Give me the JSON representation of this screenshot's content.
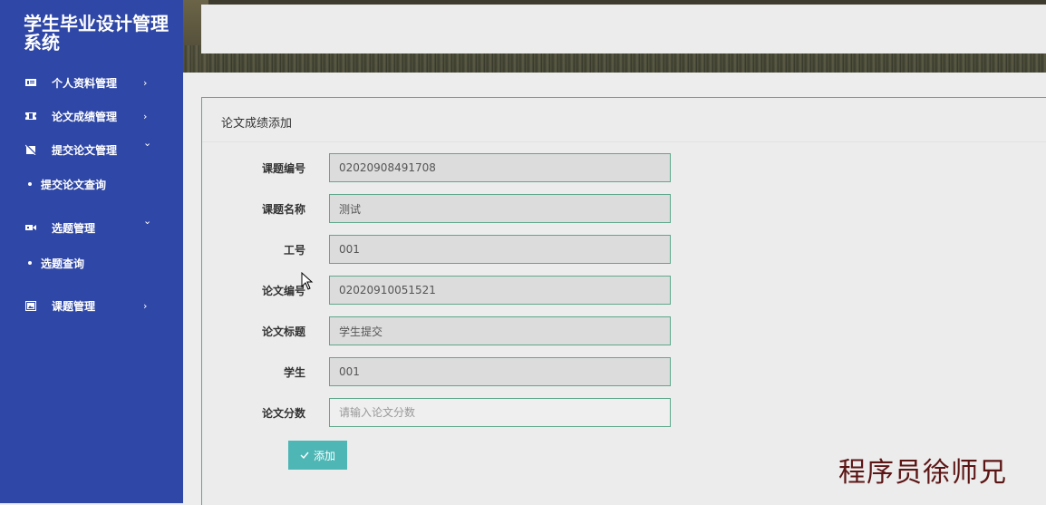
{
  "sidebar": {
    "app_title": "学生毕业设计管理系统",
    "items": [
      {
        "label": "个人资料管理",
        "icon": "id-card-icon",
        "arrow": "›"
      },
      {
        "label": "论文成绩管理",
        "icon": "ticket-icon",
        "arrow": "›"
      },
      {
        "label": "提交论文管理",
        "icon": "document-slash-icon",
        "arrow": "⌄"
      },
      {
        "label": "提交论文查询"
      },
      {
        "label": "选题管理",
        "icon": "video-camera-icon",
        "arrow": "⌄"
      },
      {
        "label": "选题查询"
      },
      {
        "label": "课题管理",
        "icon": "image-icon",
        "arrow": "›"
      }
    ]
  },
  "panel": {
    "title": "论文成绩添加"
  },
  "form": {
    "fields": [
      {
        "label": "课题编号",
        "value": "02020908491708"
      },
      {
        "label": "课题名称",
        "value": "测试"
      },
      {
        "label": "工号",
        "value": "001"
      },
      {
        "label": "论文编号",
        "value": "02020910051521"
      },
      {
        "label": "论文标题",
        "value": "学生提交"
      },
      {
        "label": "学生",
        "value": "001"
      },
      {
        "label": "论文分数",
        "value": "",
        "placeholder": "请输入论文分数"
      }
    ],
    "submit_label": "添加",
    "submit_icon": "check-icon"
  },
  "watermark": "程序员徐师兄",
  "colors": {
    "sidebar_bg": "#2f47a6",
    "input_border": "#5fa88c",
    "button_bg": "#4fb6b6",
    "watermark": "#5c1515"
  }
}
